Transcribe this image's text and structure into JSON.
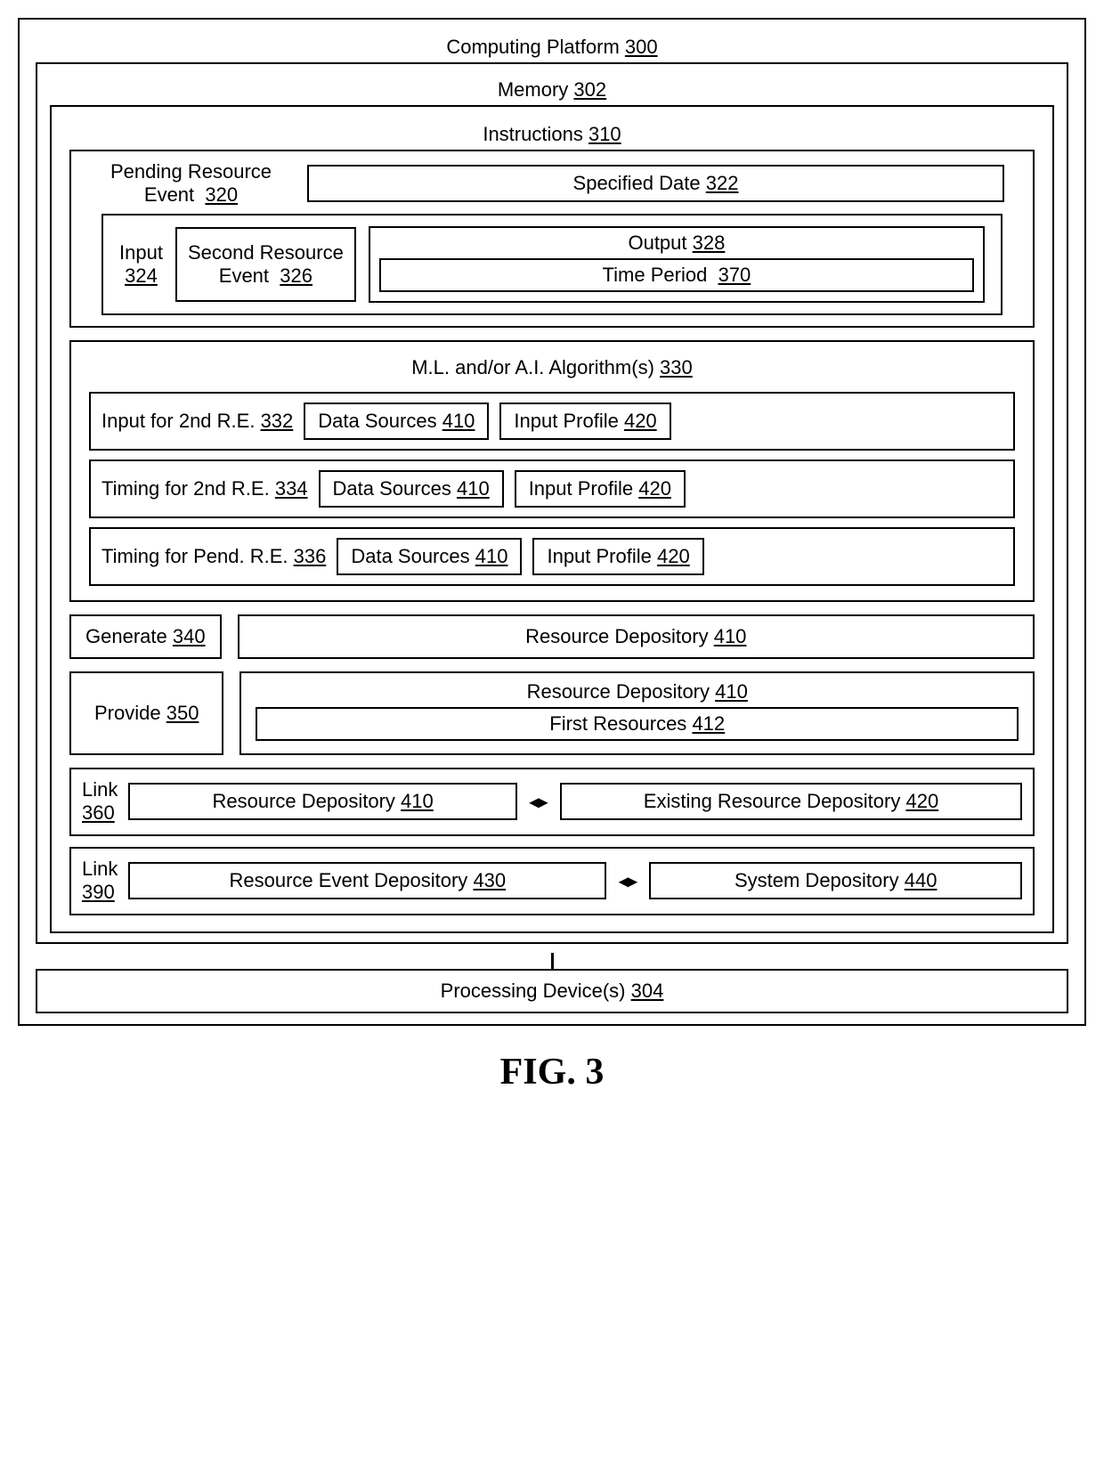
{
  "figure": "FIG. 3",
  "platform": {
    "label": "Computing Platform",
    "num": "300"
  },
  "memory": {
    "label": "Memory",
    "num": "302"
  },
  "instructions": {
    "label": "Instructions",
    "num": "310"
  },
  "pending": {
    "label": "Pending Resource Event",
    "num": "320",
    "specDate": {
      "label": "Specified Date",
      "num": "322"
    },
    "input": {
      "label": "Input",
      "num": "324"
    },
    "second": {
      "label": "Second Resource Event",
      "num": "326"
    },
    "output": {
      "label": "Output",
      "num": "328"
    },
    "timePeriod": {
      "label": "Time Period",
      "num": "370"
    }
  },
  "ml": {
    "label": "M.L. and/or A.I. Algorithm(s)",
    "num": "330",
    "rows": [
      {
        "label": "Input for 2nd R.E.",
        "num": "332",
        "ds": {
          "label": "Data Sources",
          "num": "410"
        },
        "ip": {
          "label": "Input Profile",
          "num": "420"
        }
      },
      {
        "label": "Timing for 2nd R.E.",
        "num": "334",
        "ds": {
          "label": "Data Sources",
          "num": "410"
        },
        "ip": {
          "label": "Input Profile",
          "num": "420"
        }
      },
      {
        "label": "Timing for Pend. R.E.",
        "num": "336",
        "ds": {
          "label": "Data Sources",
          "num": "410"
        },
        "ip": {
          "label": "Input Profile",
          "num": "420"
        }
      }
    ]
  },
  "generate": {
    "label": "Generate",
    "num": "340",
    "dep": {
      "label": "Resource Depository",
      "num": "410"
    }
  },
  "provide": {
    "label": "Provide",
    "num": "350",
    "dep": {
      "label": "Resource Depository",
      "num": "410"
    },
    "first": {
      "label": "First Resources",
      "num": "412"
    }
  },
  "link1": {
    "label": "Link",
    "num": "360",
    "a": {
      "label": "Resource Depository",
      "num": "410"
    },
    "b": {
      "label": "Existing Resource Depository",
      "num": "420"
    }
  },
  "link2": {
    "label": "Link",
    "num": "390",
    "a": {
      "label": "Resource Event Depository",
      "num": "430"
    },
    "b": {
      "label": "System Depository",
      "num": "440"
    }
  },
  "processing": {
    "label": "Processing Device(s)",
    "num": "304"
  },
  "arrow": "◂▸"
}
